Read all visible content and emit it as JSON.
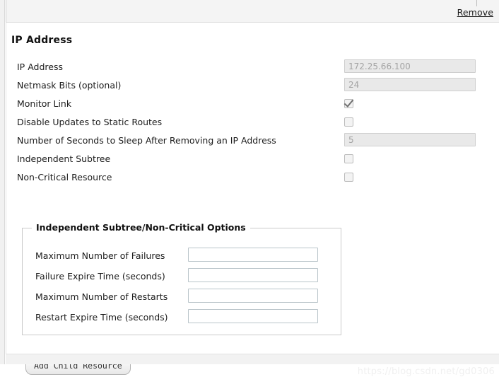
{
  "header": {
    "remove_label": "Remove"
  },
  "section": {
    "title": "IP Address"
  },
  "form": {
    "rows": [
      {
        "label": "IP Address",
        "type": "text",
        "value": "172.25.66.100",
        "disabled": true
      },
      {
        "label": "Netmask Bits (optional)",
        "type": "text",
        "value": "24",
        "disabled": true
      },
      {
        "label": "Monitor Link",
        "type": "checkbox",
        "checked": true
      },
      {
        "label": "Disable Updates to Static Routes",
        "type": "checkbox",
        "checked": false
      },
      {
        "label": "Number of Seconds to Sleep After Removing an IP Address",
        "type": "text",
        "value": "5",
        "disabled": true
      },
      {
        "label": "Independent Subtree",
        "type": "checkbox",
        "checked": false
      },
      {
        "label": "Non-Critical Resource",
        "type": "checkbox",
        "checked": false
      }
    ]
  },
  "fieldset": {
    "legend": "Independent Subtree/Non-Critical Options",
    "rows": [
      {
        "label": "Maximum Number of Failures",
        "value": "",
        "placeholder": ""
      },
      {
        "label": "Failure Expire Time (seconds)",
        "value": "",
        "placeholder": ""
      },
      {
        "label": "Maximum Number of Restarts",
        "value": "",
        "placeholder": ""
      },
      {
        "label": "Restart Expire Time (seconds)",
        "value": "",
        "placeholder": ""
      }
    ]
  },
  "footer": {
    "add_child_resource_label": "Add Child Resource",
    "watermark": "https://blog.csdn.net/gd0306"
  },
  "colors": {
    "header_bg": "#f4f4f4",
    "panel_bg": "#ffffff",
    "disabled_input_bg": "#e9e9e9",
    "disabled_input_text": "#a3a3a3",
    "text": "#1c1c1c",
    "border": "#c9c9c9",
    "watermark": "#f0f0f0"
  }
}
